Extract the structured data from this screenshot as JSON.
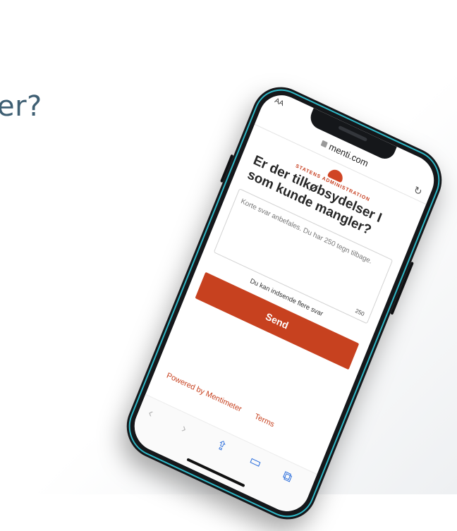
{
  "background": {
    "fragment_text": "er?"
  },
  "browser": {
    "text_size_label": "AA",
    "url": "menti.com",
    "reload_icon": "reload-icon"
  },
  "page": {
    "logo_text": "STATENS ADMINISTRATION",
    "question": "Er der tilkøbsydelser I som kunde mangler?",
    "textbox_placeholder": "Korte svar anbefales. Du har 250 tegn tilbage.",
    "char_count": "250",
    "multiple_submissions": "Du kan indsende flere svar",
    "send_label": "Send",
    "powered_by": "Powered by Mentimeter",
    "terms": "Terms"
  },
  "toolbar": {
    "back_icon": "chevron-left-icon",
    "forward_icon": "chevron-right-icon",
    "share_icon": "share-icon",
    "bookmarks_icon": "book-icon",
    "tabs_icon": "tabs-icon"
  },
  "colors": {
    "accent": "#c7411f",
    "phone_rim": "#2fb8c7",
    "ios_blue": "#2d6fdc"
  }
}
